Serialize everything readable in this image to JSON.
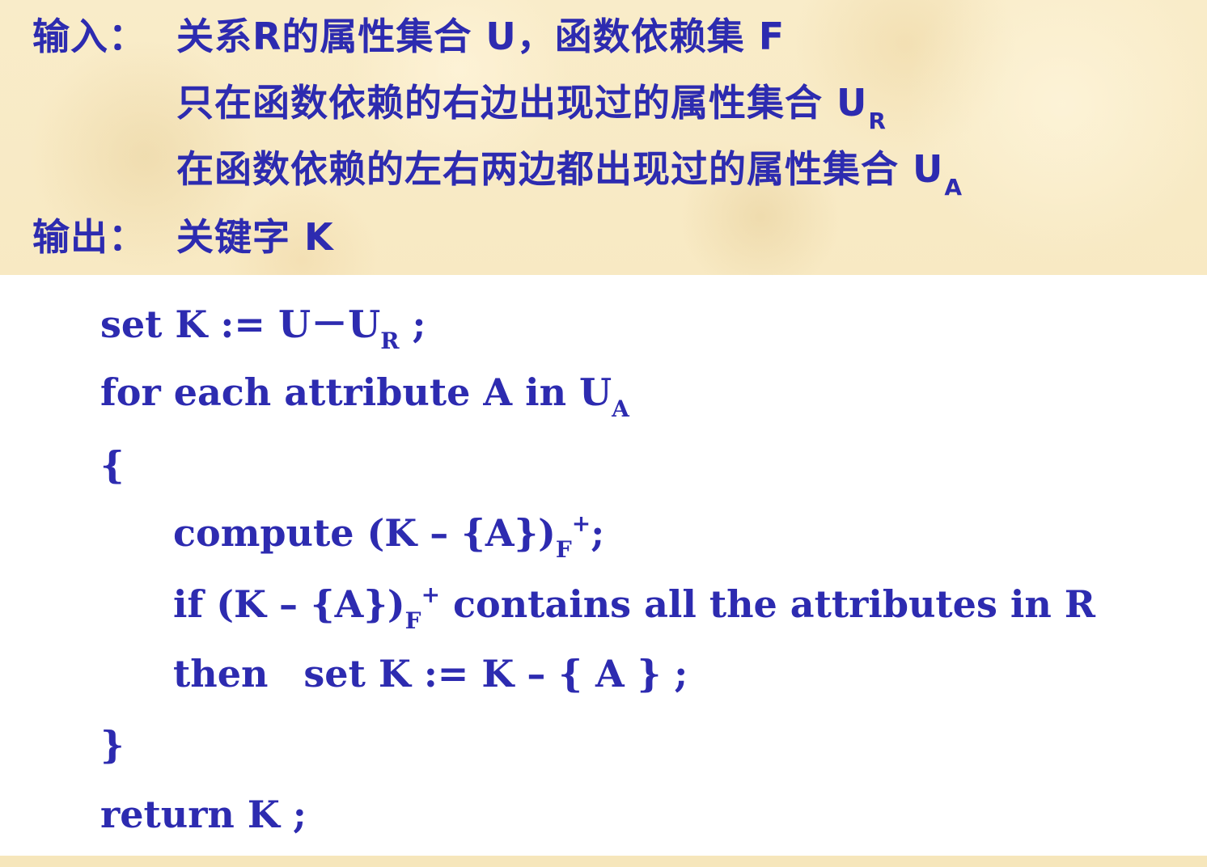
{
  "header": {
    "input_label": "输入：",
    "input_text": "关系R的属性集合 U，函数依赖集 F",
    "line2_text": "只在函数依赖的右边出现过的属性集合 U",
    "line2_sub": "R",
    "line3_text": "在函数依赖的左右两边都出现过的属性集合 U",
    "line3_sub": "A",
    "output_label": "输出：",
    "output_text": "关键字 K"
  },
  "code": {
    "line1_main": "set K := U－U",
    "line1_sub": "R",
    "line1_end": " ;",
    "line2_main": "for each attribute A in U",
    "line2_sub": "A",
    "line3": "{",
    "line4_main": "compute (K – {A})",
    "line4_sub": "F",
    "line4_sup": "+",
    "line4_end": ";",
    "line5_main": "if  (K – {A})",
    "line5_sub": "F",
    "line5_sup": "+",
    "line5_end": " contains all the attributes in R",
    "line6_kw": "then",
    "line6_rest": "set K := K – { A } ;",
    "line7": "}",
    "line8": "return K ;"
  }
}
